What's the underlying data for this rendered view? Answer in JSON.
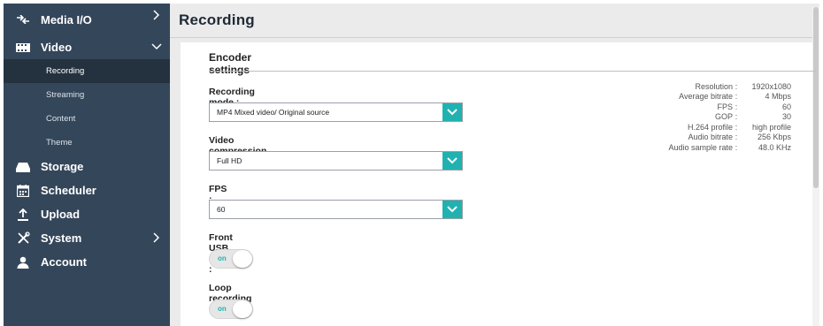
{
  "sidebar": {
    "items": [
      {
        "label": "Media I/O",
        "icon": "arrows-icon"
      },
      {
        "label": "Video",
        "icon": "film-icon"
      },
      {
        "label": "Storage",
        "icon": "tray-icon"
      },
      {
        "label": "Scheduler",
        "icon": "calendar-icon"
      },
      {
        "label": "Upload",
        "icon": "upload-icon"
      },
      {
        "label": "System",
        "icon": "tools-icon"
      },
      {
        "label": "Account",
        "icon": "user-icon"
      }
    ],
    "video_sub": [
      {
        "label": "Recording",
        "active": true
      },
      {
        "label": "Streaming"
      },
      {
        "label": "Content"
      },
      {
        "label": "Theme"
      }
    ]
  },
  "page": {
    "title": "Recording"
  },
  "encoder": {
    "section_title": "Encoder settings",
    "recording_mode": {
      "label": "Recording mode :",
      "value": "MP4 Mixed video/ Original source"
    },
    "video_compression": {
      "label": "Video compression :",
      "value": "Full HD"
    },
    "fps": {
      "label": "FPS :",
      "value": "60"
    },
    "front_usb": {
      "label": "Front USB Storage :",
      "toggle": "on"
    },
    "loop_recording": {
      "label": "Loop recording :",
      "toggle": "on"
    }
  },
  "stats": [
    {
      "label": "Resolution",
      "value": "1920x1080"
    },
    {
      "label": "Average bitrate",
      "value": "4 Mbps"
    },
    {
      "label": "FPS",
      "value": "60"
    },
    {
      "label": "GOP",
      "value": "30"
    },
    {
      "label": "H.264 profile",
      "value": "high profile"
    },
    {
      "label": "Audio bitrate",
      "value": "256 Kbps"
    },
    {
      "label": "Audio sample rate",
      "value": "48.0 KHz"
    }
  ],
  "colors": {
    "sidebar": "#34465a",
    "accent": "#20b2b0",
    "active_sub": "#24323f"
  }
}
